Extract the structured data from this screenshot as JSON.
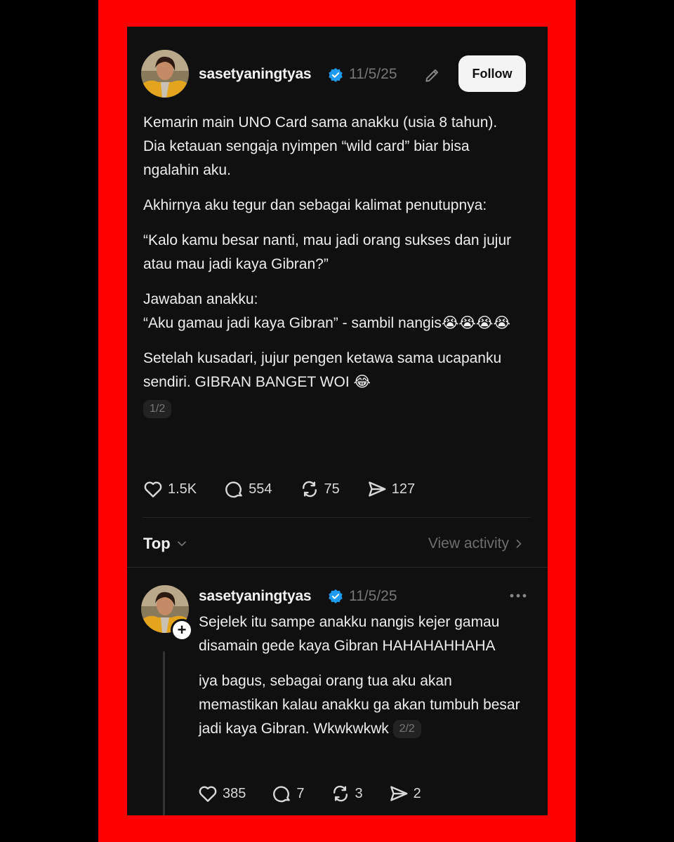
{
  "post": {
    "username": "sasetyaningtyas",
    "timestamp": "11/5/25",
    "follow_label": "Follow",
    "paragraphs": [
      "Kemarin main UNO Card sama anakku (usia 8 tahun). Dia ketauan sengaja nyimpen “wild card” biar bisa ngalahin aku.",
      "Akhirnya aku tegur dan sebagai kalimat penutupnya:",
      "“Kalo kamu besar nanti, mau jadi orang sukses dan jujur atau mau jadi kaya Gibran?”",
      "Jawaban anakku:",
      "“Aku gamau jadi kaya Gibran” - sambil nangis😭😭😭😭",
      "Setelah kusadari, jujur pengen ketawa sama ucapanku sendiri. GIBRAN BANGET WOI 😂"
    ],
    "page_indicator": "1/2",
    "likes": "1.5K",
    "comments": "554",
    "reposts": "75",
    "shares": "127"
  },
  "sort": {
    "label": "Top",
    "view_activity": "View activity"
  },
  "reply": {
    "username": "sasetyaningtyas",
    "timestamp": "11/5/25",
    "paragraphs": [
      "Sejelek itu sampe anakku nangis kejer gamau disamain gede kaya Gibran HAHAHAHHAHA",
      "iya bagus, sebagai orang tua aku akan memastikan kalau anakku ga akan tumbuh besar jadi kaya Gibran. Wkwkwkwk"
    ],
    "page_indicator": "2/2",
    "likes": "385",
    "comments": "7",
    "reposts": "3",
    "shares": "2"
  },
  "colors": {
    "frame": "#ff0000",
    "background": "#101010",
    "verified": "#1d9bf0"
  }
}
